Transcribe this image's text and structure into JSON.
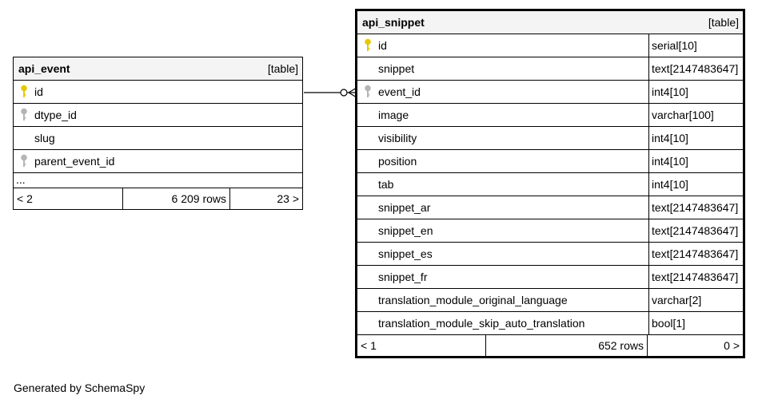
{
  "colors": {
    "primary_key": "#e6c800",
    "foreign_key": "#b5b5b5",
    "header_bg": "#f4f4f4"
  },
  "api_event": {
    "name": "api_event",
    "kind": "[table]",
    "columns": [
      {
        "name": "id",
        "key": "primary",
        "icon": "primary-key-icon"
      },
      {
        "name": "dtype_id",
        "key": "foreign",
        "icon": "foreign-key-icon"
      },
      {
        "name": "slug",
        "key": ""
      },
      {
        "name": "parent_event_id",
        "key": "foreign",
        "icon": "foreign-key-icon"
      }
    ],
    "more": "...",
    "footer": {
      "parents": "< 2",
      "rows": "6 209 rows",
      "children": "23 >"
    }
  },
  "api_snippet": {
    "name": "api_snippet",
    "kind": "[table]",
    "columns": [
      {
        "name": "id",
        "type": "serial[10]",
        "key": "primary",
        "icon": "primary-key-icon"
      },
      {
        "name": "snippet",
        "type": "text[2147483647]",
        "key": ""
      },
      {
        "name": "event_id",
        "type": "int4[10]",
        "key": "foreign",
        "icon": "foreign-key-icon"
      },
      {
        "name": "image",
        "type": "varchar[100]",
        "key": ""
      },
      {
        "name": "visibility",
        "type": "int4[10]",
        "key": ""
      },
      {
        "name": "position",
        "type": "int4[10]",
        "key": ""
      },
      {
        "name": "tab",
        "type": "int4[10]",
        "key": ""
      },
      {
        "name": "snippet_ar",
        "type": "text[2147483647]",
        "key": ""
      },
      {
        "name": "snippet_en",
        "type": "text[2147483647]",
        "key": ""
      },
      {
        "name": "snippet_es",
        "type": "text[2147483647]",
        "key": ""
      },
      {
        "name": "snippet_fr",
        "type": "text[2147483647]",
        "key": ""
      },
      {
        "name": "translation_module_original_language",
        "type": "varchar[2]",
        "key": ""
      },
      {
        "name": "translation_module_skip_auto_translation",
        "type": "bool[1]",
        "key": ""
      }
    ],
    "footer": {
      "parents": "< 1",
      "rows": "652 rows",
      "children": "0 >"
    }
  },
  "credit": "Generated by SchemaSpy"
}
